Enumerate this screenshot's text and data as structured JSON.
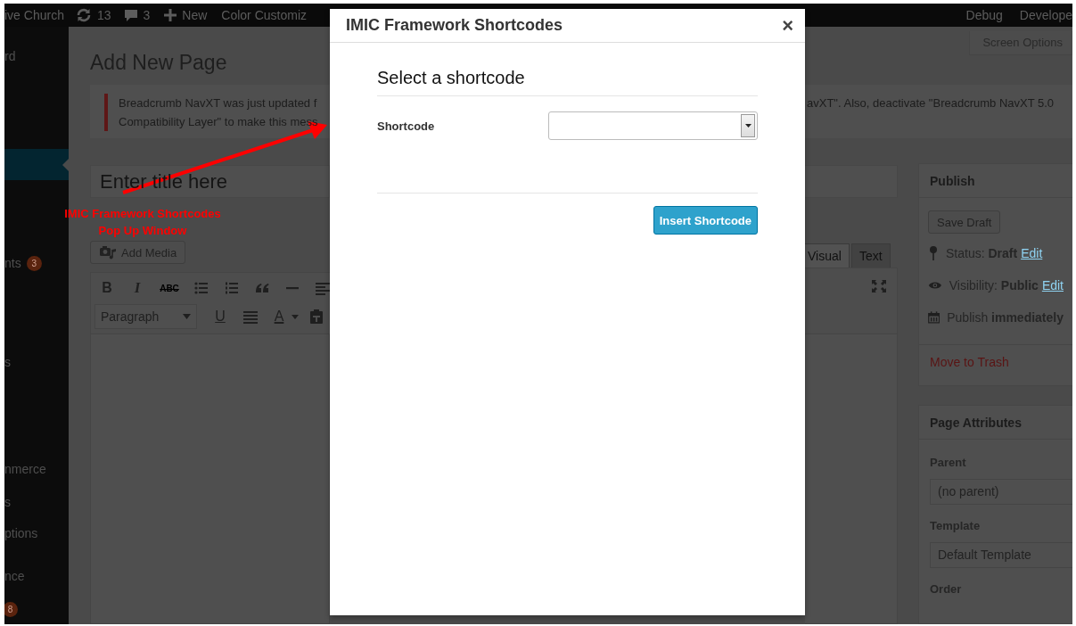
{
  "admin_bar": {
    "site_name": "ive Church",
    "updates": "13",
    "comments": "3",
    "new_label": "New",
    "customize_label": "Color Customiz",
    "right_links": [
      "Debug",
      "Develope"
    ]
  },
  "sidebar": {
    "items": [
      {
        "label": "rd",
        "selected": false
      },
      {
        "selected": true
      },
      {
        "label": "nts",
        "badge": "3",
        "selected": false
      },
      {
        "label": "s",
        "selected": false
      },
      {
        "label": "nmerce",
        "selected": false
      },
      {
        "label": "s",
        "selected": false
      },
      {
        "label": "ptions",
        "selected": false
      },
      {
        "label": "nce",
        "selected": false
      },
      {
        "badge": "8",
        "selected": false
      }
    ]
  },
  "page": {
    "heading": "Add New Page",
    "screen_options": "Screen Options",
    "notice": {
      "left_lines": [
        "Breadcrumb NavXT was just updated f",
        "Compatibility Layer\" to make this mess"
      ],
      "right_text": "avXT\". Also, deactivate \"Breadcrumb NavXT 5.0"
    },
    "title_field": {
      "placeholder": "Enter title here"
    },
    "add_media": "Add Media",
    "editor_tabs": [
      {
        "label": "Visual",
        "selected": true
      },
      {
        "label": "Text",
        "selected": false
      }
    ],
    "toolbar_rows": [
      [
        {
          "kind": "bold",
          "text": "B"
        },
        {
          "kind": "italic",
          "text": "I"
        },
        {
          "kind": "strike",
          "text": "ABC"
        },
        {
          "kind": "ul"
        },
        {
          "kind": "ol"
        },
        {
          "kind": "quote"
        },
        {
          "kind": "hr"
        },
        {
          "kind": "align"
        }
      ],
      [
        {
          "kind": "format",
          "text": "Paragraph"
        },
        {
          "kind": "underline",
          "text": "U"
        },
        {
          "kind": "justify"
        },
        {
          "kind": "textcolor",
          "text": "A"
        },
        {
          "kind": "paste"
        }
      ]
    ]
  },
  "publish_box": {
    "title": "Publish",
    "save_draft": "Save Draft",
    "rows": [
      {
        "kind": "status",
        "text": "Status: **Draft**",
        "link": "Edit"
      },
      {
        "kind": "visibility",
        "text": "Visibility: **Public**",
        "link": "Edit"
      },
      {
        "kind": "schedule",
        "text": "Publish **immediately**"
      }
    ],
    "trash_link": "Move to Trash"
  },
  "page_attributes": {
    "title": "Page Attributes",
    "fields": [
      {
        "kind": "select",
        "label": "Parent",
        "value": "(no parent)"
      },
      {
        "kind": "select",
        "label": "Template",
        "value": "Default Template"
      },
      {
        "kind": "label",
        "label": "Order"
      }
    ]
  },
  "modal": {
    "title": "IMIC Framework Shortcodes",
    "close": "×",
    "heading": "Select a shortcode",
    "field_label": "Shortcode",
    "insert_button": "Insert Shortcode"
  },
  "annotation": {
    "lines": [
      "IMIC Framework Shortcodes",
      "Pop Up Window"
    ]
  }
}
